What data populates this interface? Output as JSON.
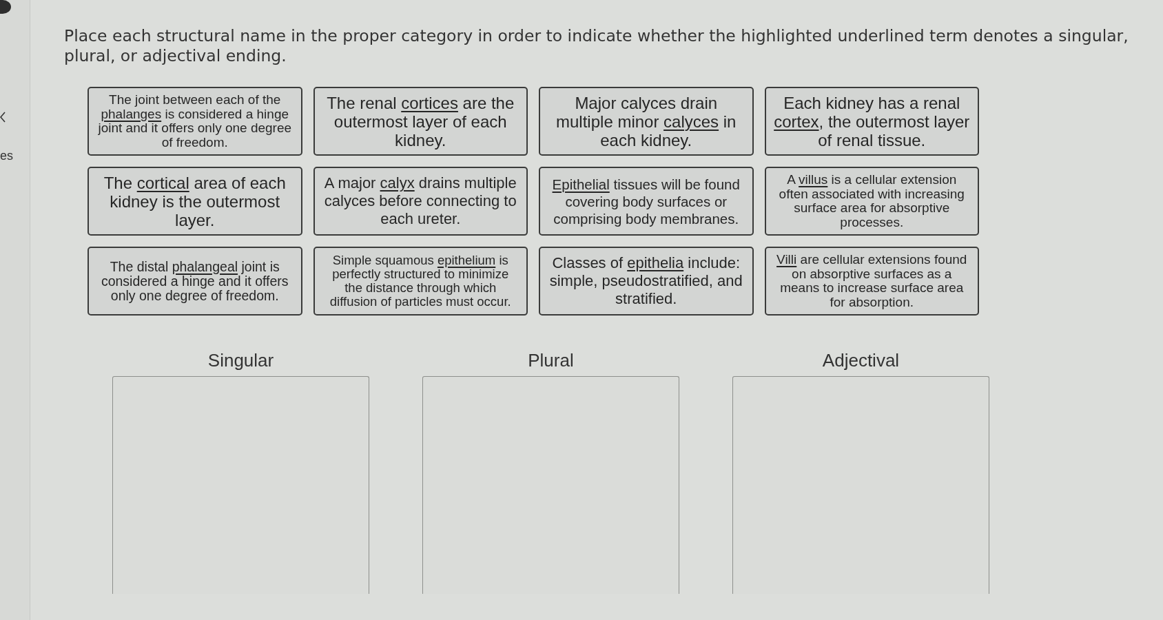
{
  "side_panel": {
    "label": "es"
  },
  "instructions": "Place each structural name in the proper category in order to indicate whether the highlighted underlined term denotes a singular, plural, or adjectival ending.",
  "cards": [
    {
      "parts": [
        {
          "text": "The joint between each of the ",
          "underlined": false
        },
        {
          "text": "phalanges",
          "underlined": true
        },
        {
          "text": " is considered a hinge joint and it offers only one degree of freedom.",
          "underlined": false
        }
      ]
    },
    {
      "parts": [
        {
          "text": "The renal ",
          "underlined": false
        },
        {
          "text": "cortices",
          "underlined": true
        },
        {
          "text": " are the outermost layer of each kidney.",
          "underlined": false
        }
      ]
    },
    {
      "parts": [
        {
          "text": "Major calyces drain multiple minor ",
          "underlined": false
        },
        {
          "text": "calyces",
          "underlined": true
        },
        {
          "text": " in each kidney.",
          "underlined": false
        }
      ]
    },
    {
      "parts": [
        {
          "text": "Each kidney has a renal ",
          "underlined": false
        },
        {
          "text": "cortex",
          "underlined": true
        },
        {
          "text": ", the outermost layer of renal tissue.",
          "underlined": false
        }
      ]
    },
    {
      "parts": [
        {
          "text": "The ",
          "underlined": false
        },
        {
          "text": "cortical",
          "underlined": true
        },
        {
          "text": " area of each kidney is the outermost layer.",
          "underlined": false
        }
      ]
    },
    {
      "parts": [
        {
          "text": "A major ",
          "underlined": false
        },
        {
          "text": "calyx",
          "underlined": true
        },
        {
          "text": " drains multiple calyces before connecting to each ureter.",
          "underlined": false
        }
      ]
    },
    {
      "parts": [
        {
          "text": "Epithelial",
          "underlined": true
        },
        {
          "text": " tissues will be found covering body surfaces or comprising body membranes.",
          "underlined": false
        }
      ]
    },
    {
      "parts": [
        {
          "text": "A ",
          "underlined": false
        },
        {
          "text": "villus",
          "underlined": true
        },
        {
          "text": " is a cellular extension often associated with increasing surface area for absorptive processes.",
          "underlined": false
        }
      ]
    },
    {
      "parts": [
        {
          "text": "The distal ",
          "underlined": false
        },
        {
          "text": "phalangeal",
          "underlined": true
        },
        {
          "text": " joint is considered a hinge and it offers only one degree of freedom.",
          "underlined": false
        }
      ]
    },
    {
      "parts": [
        {
          "text": "Simple squamous ",
          "underlined": false
        },
        {
          "text": "epithelium",
          "underlined": true
        },
        {
          "text": " is perfectly structured to minimize the distance through which diffusion of particles must occur.",
          "underlined": false
        }
      ]
    },
    {
      "parts": [
        {
          "text": "Classes of ",
          "underlined": false
        },
        {
          "text": "epithelia",
          "underlined": true
        },
        {
          "text": " include: simple, pseudostratified, and stratified.",
          "underlined": false
        }
      ]
    },
    {
      "parts": [
        {
          "text": "Villi",
          "underlined": true
        },
        {
          "text": " are cellular extensions found on absorptive surfaces as a means to increase surface area for absorption.",
          "underlined": false
        }
      ]
    }
  ],
  "categories": [
    {
      "label": "Singular"
    },
    {
      "label": "Plural"
    },
    {
      "label": "Adjectival"
    }
  ]
}
